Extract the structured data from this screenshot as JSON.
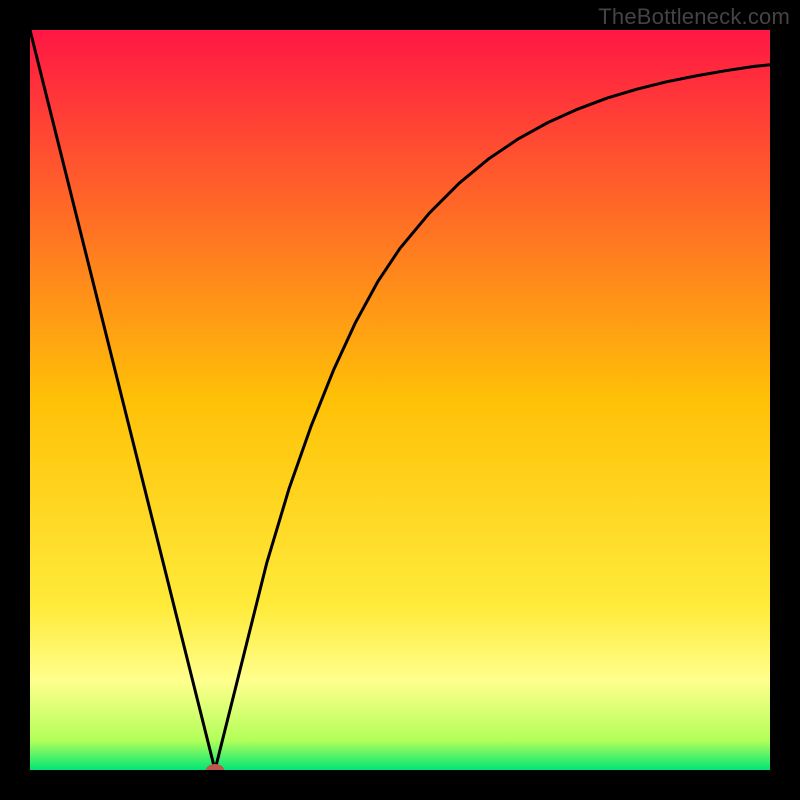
{
  "watermark": "TheBottleneck.com",
  "chart_data": {
    "type": "line",
    "title": "",
    "xlabel": "",
    "ylabel": "",
    "xlim": [
      0,
      100
    ],
    "ylim": [
      0,
      100
    ],
    "grid": false,
    "x": [
      0,
      2,
      4,
      6,
      8,
      10,
      12,
      14,
      16,
      18,
      20,
      22,
      24,
      25,
      26,
      28,
      30,
      32,
      35,
      38,
      41,
      44,
      47,
      50,
      54,
      58,
      62,
      66,
      70,
      74,
      78,
      82,
      86,
      90,
      94,
      98,
      100
    ],
    "values": [
      100,
      92,
      84,
      76,
      68,
      60,
      52,
      44,
      36,
      28,
      20,
      12,
      4,
      0,
      4,
      12,
      20,
      28,
      38,
      46.5,
      54,
      60.5,
      66,
      70.5,
      75.3,
      79.3,
      82.6,
      85.3,
      87.5,
      89.3,
      90.8,
      92,
      93,
      93.8,
      94.5,
      95.1,
      95.3
    ],
    "background_gradient": {
      "stops": [
        {
          "offset": 0,
          "color": "#ff1744"
        },
        {
          "offset": 50,
          "color": "#ffc107"
        },
        {
          "offset": 78,
          "color": "#ffeb3b"
        },
        {
          "offset": 88,
          "color": "#ffff8d"
        },
        {
          "offset": 96,
          "color": "#b2ff59"
        },
        {
          "offset": 100,
          "color": "#00e676"
        }
      ]
    },
    "marker": {
      "x": 25,
      "y": 0,
      "color": "#c0564b"
    }
  }
}
